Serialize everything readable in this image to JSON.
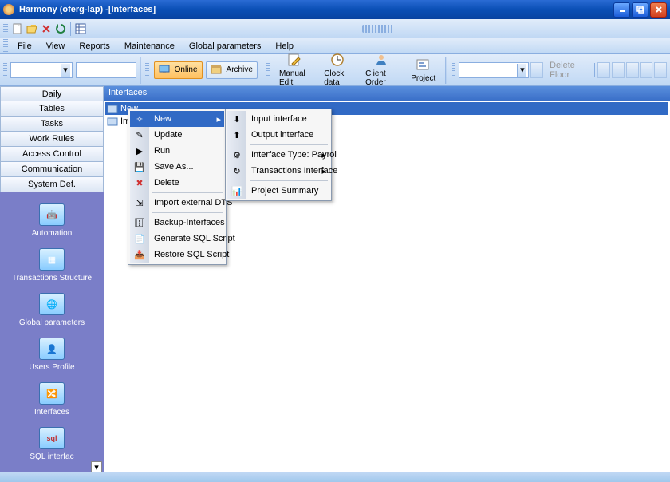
{
  "title": "Harmony (oferg-lap) -[Interfaces]",
  "menus": {
    "file": "File",
    "view": "View",
    "reports": "Reports",
    "maintenance": "Maintenance",
    "global": "Global parameters",
    "help": "Help"
  },
  "toolbar": {
    "online": "Online",
    "archive": "Archive",
    "manual_edit": "Manual Edit",
    "clock_data": "Clock data",
    "client_order": "Client Order",
    "project": "Project",
    "delete_floor": "Delete Floor"
  },
  "navtabs": [
    "Daily",
    "Tables",
    "Tasks",
    "Work Rules",
    "Access Control",
    "Communication",
    "System Def."
  ],
  "navicons": [
    {
      "label": "Automation"
    },
    {
      "label": "Transactions Structure"
    },
    {
      "label": "Global parameters"
    },
    {
      "label": "Users Profile"
    },
    {
      "label": "Interfaces"
    },
    {
      "label": "SQL interfac"
    }
  ],
  "content_header": "Interfaces",
  "tree": {
    "item1": "New",
    "item2": "Imp"
  },
  "ctx1": {
    "new": "New",
    "update": "Update",
    "run": "Run",
    "saveas": "Save As...",
    "delete": "Delete",
    "import_dts": "Import external DTS",
    "backup": "Backup-Interfaces",
    "gensql": "Generate SQL Script",
    "restoresql": "Restore SQL Script"
  },
  "ctx2": {
    "input_if": "Input interface",
    "output_if": "Output interface",
    "if_type": "Interface Type: Payrol",
    "trans_if": "Transactions Interface",
    "proj_sum": "Project Summary"
  }
}
